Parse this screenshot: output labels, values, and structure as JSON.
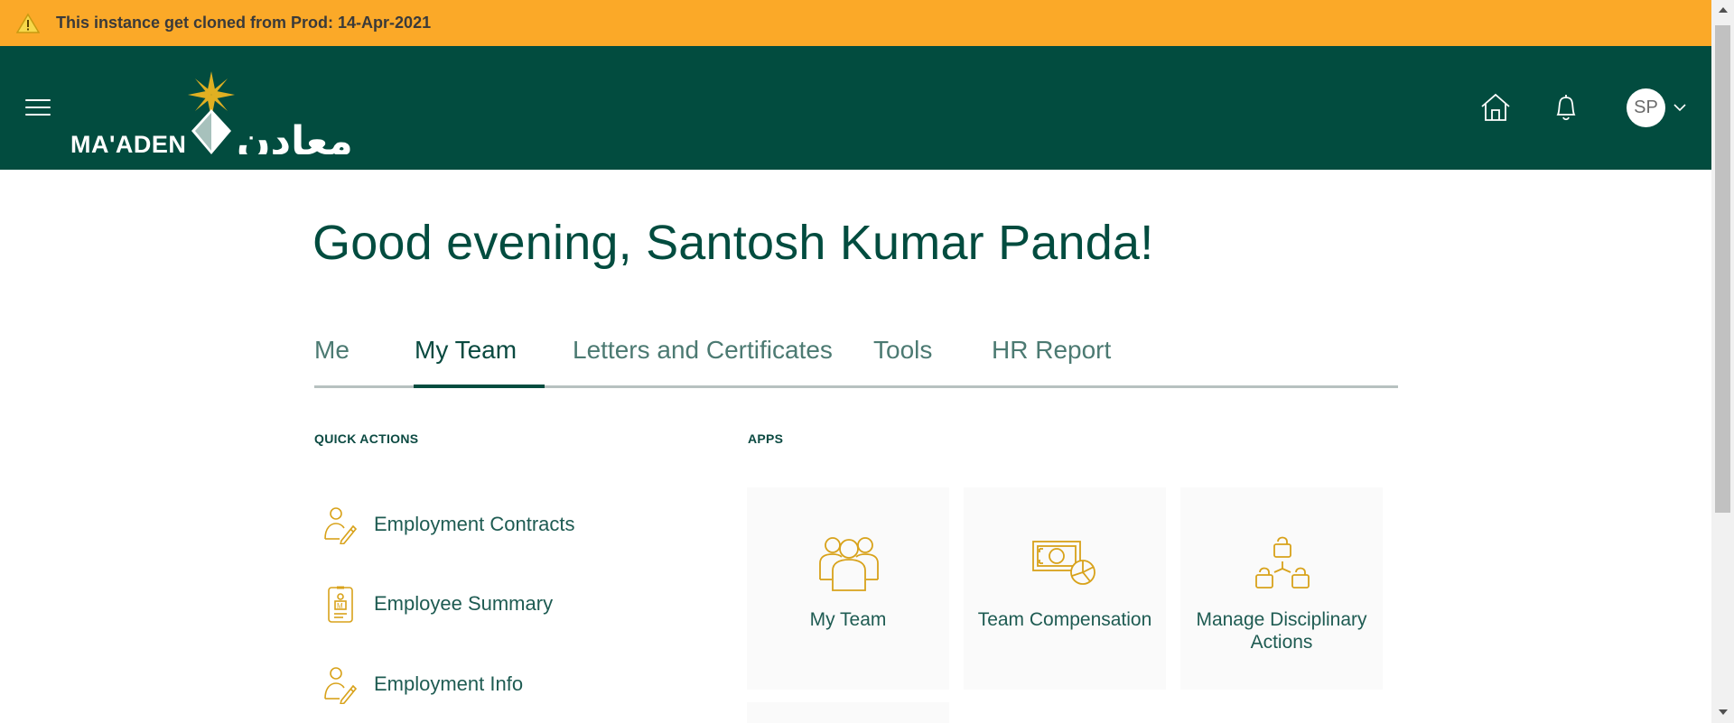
{
  "banner": {
    "icon": "warning-icon",
    "message": "This instance get cloned from Prod: 14-Apr-2021",
    "color": "#fba928"
  },
  "header": {
    "brand_color": "#024c3f",
    "logo": {
      "latin": "MA'ADEN",
      "arabic": "معادن"
    },
    "avatar_initials": "SP",
    "icons": [
      "menu-icon",
      "home-icon",
      "bell-icon",
      "chevron-down-icon"
    ]
  },
  "greeting": "Good evening, Santosh Kumar Panda!",
  "tabs": [
    {
      "label": "Me",
      "active": false
    },
    {
      "label": "My Team",
      "active": true
    },
    {
      "label": "Letters and Certificates",
      "active": false
    },
    {
      "label": "Tools",
      "active": false
    },
    {
      "label": "HR Report",
      "active": false
    }
  ],
  "quick_actions": {
    "heading": "QUICK ACTIONS",
    "items": [
      {
        "label": "Employment Contracts",
        "icon": "person-edit-icon"
      },
      {
        "label": "Employee Summary",
        "icon": "id-badge-icon"
      },
      {
        "label": "Employment Info",
        "icon": "person-edit-icon"
      }
    ]
  },
  "apps": {
    "heading": "APPS",
    "items": [
      {
        "label": "My Team",
        "icon": "team-icon"
      },
      {
        "label": "Team Compensation",
        "icon": "compensation-icon"
      },
      {
        "label": "Manage Disciplinary Actions",
        "icon": "hierarchy-icon"
      }
    ]
  },
  "accent_color": "#d8a21a"
}
